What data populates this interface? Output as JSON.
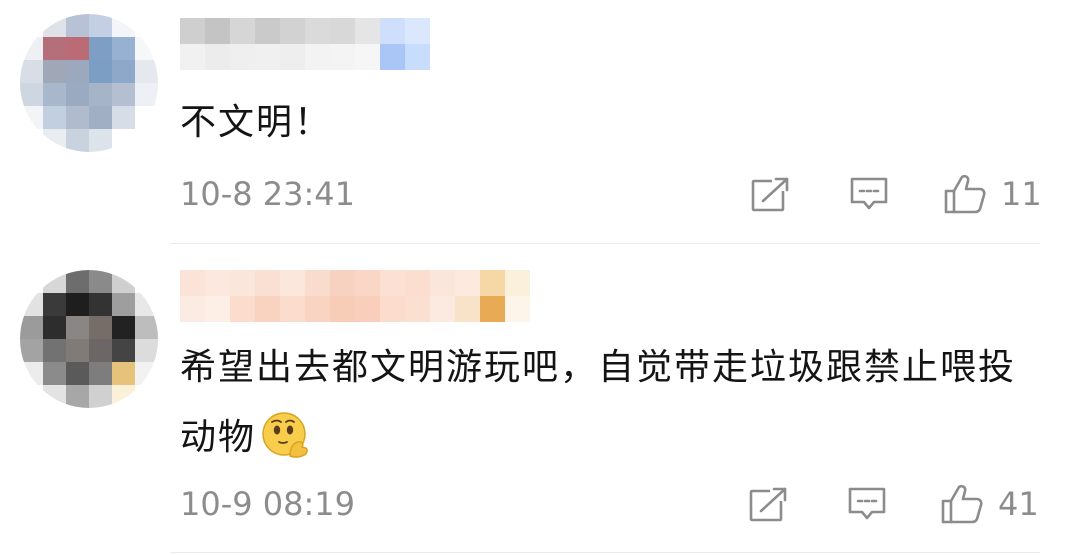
{
  "comments": [
    {
      "text": "不文明！",
      "timestamp": "10-8 23:41",
      "like_count": "11",
      "avatar_colors": [
        "#ffffff",
        "#dfe2e9",
        "#b7c2d6",
        "#c3d0e3",
        "#f3f5f8",
        "#ffffff",
        "#eef0f4",
        "#b46f7a",
        "#bb6b73",
        "#7f9ec6",
        "#96b1d2",
        "#f6f7f9",
        "#d8dde6",
        "#a0a7b6",
        "#9ca8bd",
        "#7c9dc4",
        "#8ea8c9",
        "#e5e9ef",
        "#ced6e2",
        "#a8b7cc",
        "#9aaac1",
        "#a6b4c7",
        "#b4c0d1",
        "#edf0f4",
        "#f2f4f7",
        "#c1cfe0",
        "#b0bccd",
        "#a1afc4",
        "#d7dde6",
        "#ffffff",
        "#ffffff",
        "#e9edf2",
        "#c9d3e0",
        "#dde3eb",
        "#ffffff",
        "#ffffff"
      ],
      "username_colors": [
        "#cfcfcf",
        "#c4c4c4",
        "#d6d6d6",
        "#cacaca",
        "#d2d2d2",
        "#dadada",
        "#d8d8d8",
        "#e5e5e5",
        "#cfdffb",
        "#dbe7fc",
        "#f1f1f1",
        "#ececec",
        "#efefef",
        "#f0f0f0",
        "#eeeeee",
        "#f3f3f3",
        "#f4f4f4",
        "#f6f6f6",
        "#a9c6f6",
        "#c8dcfb"
      ]
    },
    {
      "text": "希望出去都文明游玩吧，自觉带走垃圾跟禁止喂投动物",
      "timestamp": "10-9 08:19",
      "like_count": "41",
      "avatar_colors": [
        "#ffffff",
        "#d7d7d7",
        "#6d6d6d",
        "#8a8a8a",
        "#cfcfcf",
        "#ffffff",
        "#e2e2e2",
        "#3a3a3a",
        "#1e1e1e",
        "#333333",
        "#9e9e9e",
        "#e8e8e8",
        "#9b9b9b",
        "#2d2d2d",
        "#8a8684",
        "#766d69",
        "#222222",
        "#bdbdbd",
        "#a3a3a3",
        "#727272",
        "#807b77",
        "#6c6766",
        "#444444",
        "#dcdcdc",
        "#ececec",
        "#8b8b8b",
        "#5a5a5a",
        "#7d7d7d",
        "#e6c27a",
        "#f2f2f2",
        "#ffffff",
        "#e3e3e3",
        "#a7a7a7",
        "#d0d0d0",
        "#fbf0d8",
        "#ffffff"
      ],
      "username_colors": [
        "#fbe3d8",
        "#fde8df",
        "#fbe6dc",
        "#fadfd3",
        "#fce7dd",
        "#fadccf",
        "#f8d2c1",
        "#f9d6c6",
        "#fbe0d3",
        "#fcded0",
        "#fbe6db",
        "#fde9dd",
        "#f6d7a6",
        "#fbf0dc",
        "#fcebe3",
        "#fdeee6",
        "#fbdccd",
        "#f9d3c0",
        "#fcdccd",
        "#fad4c3",
        "#f8cdb8",
        "#f9cfbb",
        "#fbdccd",
        "#fbe0d2",
        "#fce9df",
        "#f8e3c8",
        "#e9aa55",
        "#fdf5ea"
      ]
    }
  ],
  "icons": {
    "share": "share-icon",
    "reply": "reply-icon",
    "like": "thumbs-up-icon",
    "emoji": "thinking-face-emoji"
  },
  "colors": {
    "text": "#141414",
    "meta": "#8c8c8c",
    "icon": "#8c8c8c",
    "divider": "#ececec",
    "emoji_yellow": "#f7cd4b"
  }
}
